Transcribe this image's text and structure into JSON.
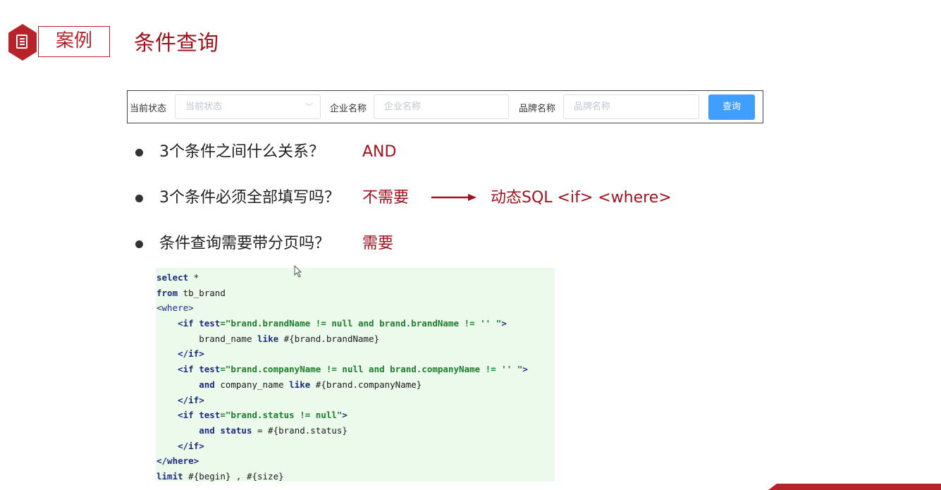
{
  "header": {
    "tag": "案例",
    "title": "条件查询"
  },
  "form": {
    "status_label": "当前状态",
    "status_placeholder": "当前状态",
    "company_label": "企业名称",
    "company_placeholder": "企业名称",
    "brand_label": "品牌名称",
    "brand_placeholder": "品牌名称",
    "query_button": "查询"
  },
  "bullets": [
    {
      "q": "3个条件之间什么关系？",
      "a": "AND"
    },
    {
      "q": "3个条件必须全部填写吗？",
      "a": "不需要",
      "a2": "动态SQL   <if>  <where>"
    },
    {
      "q": "条件查询需要带分页吗？",
      "a": "需要"
    }
  ],
  "code": {
    "l1_kw": "select",
    "l1_rest": " *",
    "l2_kw": "from",
    "l2_rest": " tb_brand",
    "l3": "<where>",
    "l4_tag": "<if ",
    "l4_attr": "test",
    "l4_str": "=\"brand.brandName != null and brand.brandName != '' \"",
    "l4_end": ">",
    "l5_a": "brand_name ",
    "l5_kw": "like",
    "l5_b": " #{brand.brandName}",
    "l6": "</if>",
    "l7_tag": "<if ",
    "l7_attr": "test",
    "l7_str": "=\"brand.companyName != null and brand.companyName != '' \"",
    "l7_end": ">",
    "l8_kw": "and",
    "l8_a": " company_name ",
    "l8_kw2": "like",
    "l8_b": " #{brand.companyName}",
    "l9": "</if>",
    "l10_tag": "<if ",
    "l10_attr": "test",
    "l10_str": "=\"brand.status != null\"",
    "l10_end": ">",
    "l11_kw": "and",
    "l11_a": " ",
    "l11_kw2": "status",
    "l11_b": " = #{brand.status}",
    "l12": "</if>",
    "l13": "</where>",
    "l14_kw": "limit",
    "l14_rest": " #{begin} , #{size}"
  },
  "colors": {
    "accent": "#b8222b",
    "answer": "#a0121d",
    "button": "#409eff",
    "code_bg": "#ecfaec"
  }
}
